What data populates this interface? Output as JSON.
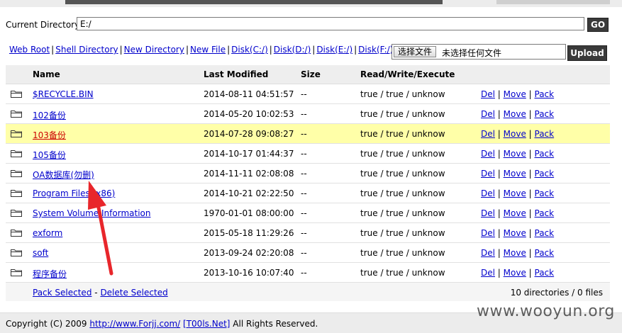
{
  "directory": {
    "label": "Current Directory",
    "value": "E:/",
    "go_label": "GO"
  },
  "toolbar": {
    "links": [
      "Web Root",
      "Shell Directory",
      "New Directory",
      "New File",
      "Disk(C:/)",
      "Disk(D:/)",
      "Disk(E:/)",
      "Disk(F:/)"
    ],
    "choose_label": "选择文件",
    "no_file_text": "未选择任何文件",
    "upload_label": "Upload"
  },
  "table": {
    "headers": {
      "name": "Name",
      "modified": "Last Modified",
      "size": "Size",
      "perm": "Read/Write/Execute"
    },
    "rows": [
      {
        "name": "$RECYCLE.BIN",
        "modified": "2014-08-11 04:51:57",
        "size": "--",
        "perm": "true / true / unknow"
      },
      {
        "name": "102备份",
        "modified": "2014-05-20 10:02:53",
        "size": "--",
        "perm": "true / true / unknow"
      },
      {
        "name": "103备份",
        "modified": "2014-07-28 09:08:27",
        "size": "--",
        "perm": "true / true / unknow",
        "highlight": true
      },
      {
        "name": "105备份",
        "modified": "2014-10-17 01:44:37",
        "size": "--",
        "perm": "true / true / unknow"
      },
      {
        "name": "OA数据库(勿删)",
        "modified": "2014-11-11 02:08:08",
        "size": "--",
        "perm": "true / true / unknow"
      },
      {
        "name": "Program Files (x86)",
        "modified": "2014-10-21 02:22:50",
        "size": "--",
        "perm": "true / true / unknow"
      },
      {
        "name": "System Volume Information",
        "modified": "1970-01-01 08:00:00",
        "size": "--",
        "perm": "true / true / unknow"
      },
      {
        "name": "exform",
        "modified": "2015-05-18 11:29:26",
        "size": "--",
        "perm": "true / true / unknow"
      },
      {
        "name": "soft",
        "modified": "2013-09-24 02:20:08",
        "size": "--",
        "perm": "true / true / unknow"
      },
      {
        "name": "程序备份",
        "modified": "2013-10-16 10:07:40",
        "size": "--",
        "perm": "true / true / unknow"
      }
    ],
    "actions": {
      "del": "Del",
      "move": "Move",
      "pack": "Pack"
    },
    "pack_selected": "Pack Selected",
    "delete_selected": "Delete Selected",
    "foot_sep": "-",
    "summary": "10 directories / 0 files"
  },
  "footer": {
    "copyright": "Copyright (C) 2009",
    "site_link": "http://www.Forjj.com/",
    "team_link": "[T00ls.Net]",
    "reserved": "All Rights Reserved."
  },
  "watermark": "www.wooyun.org",
  "colors": {
    "highlight_row": "#ffffa8",
    "arrow": "#e8262b",
    "link": "#0000cc"
  }
}
